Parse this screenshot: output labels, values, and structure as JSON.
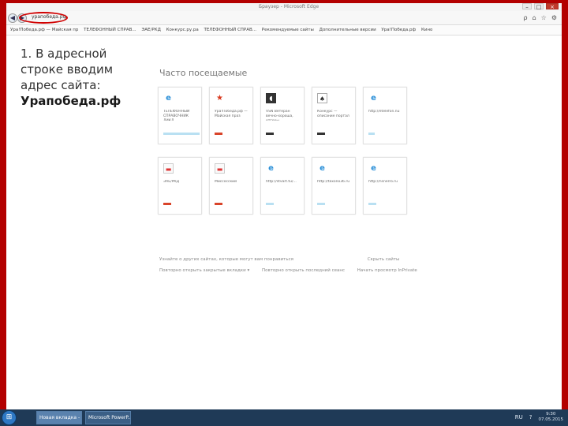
{
  "window": {
    "title": "Браузер - Microsoft Edge",
    "minimize_glyph": "–",
    "maximize_glyph": "□",
    "close_glyph": "×"
  },
  "navbar": {
    "back_glyph": "◀",
    "forward_glyph": "▶",
    "address": "урапобеда.рф",
    "search_glyph": "ρ",
    "home_glyph": "⌂",
    "favorites_glyph": "☆",
    "settings_glyph": "⚙"
  },
  "favbar": {
    "items": [
      "Ура!Победа.рф — Майская пр",
      "ТЕЛЕФОННЫЙ СПРАВ...",
      "ЭАЕ/РКД",
      "Конкурс.ру.ра",
      "ТЕЛЕФОННЫЙ СПРАВ...",
      "Рекомендуемые сайты",
      "Дополнительные версии",
      "Ура!Победа.рф",
      "Кино"
    ]
  },
  "instruction": {
    "line1": "1. В адресной",
    "line2": "строке вводим",
    "line3": "адрес сайта:",
    "site": "Урапобеда.рф"
  },
  "section_title": "Часто посещаемые",
  "tiles": [
    {
      "label": "ТЕЛЕФОННЫЙ СПРАВОЧНИК ЛИКД",
      "bar_color": "#b9e0f2",
      "icon_glyph": "e"
    },
    {
      "label": "Ура!Победа.рф — Майская праз",
      "bar_color": "#d9442a",
      "icon_glyph": "★"
    },
    {
      "label": "VSN Ветеран вечно-хороша, отгоры",
      "bar_color": "#333333",
      "icon_glyph": "◖"
    },
    {
      "label": "Конкурс — описание портал",
      "bar_color": "#333333",
      "icon_glyph": "♠"
    },
    {
      "label": "http://etelefon.nu",
      "bar_color": "#b9e0f2",
      "icon_glyph": "e"
    },
    {
      "label": "ЭАЕ/РКД",
      "bar_color": "#d9442a",
      "icon_glyph": "▬"
    },
    {
      "label": "Миссосский",
      "bar_color": "#d9442a",
      "icon_glyph": "▬"
    },
    {
      "label": "http://stvart.tu/...",
      "bar_color": "#b9e0f2",
      "icon_glyph": "e"
    },
    {
      "label": "http://taxono36.ru",
      "bar_color": "#b9e0f2",
      "icon_glyph": "e"
    },
    {
      "label": "http://nsnerro.ru",
      "bar_color": "#b9e0f2",
      "icon_glyph": "e"
    }
  ],
  "bottom_links": {
    "row1_left": "Узнайте о других сайтах, которые могут вам понравиться",
    "row1_right": "Скрыть сайты",
    "row2_a": "Повторно открыть закрытые вкладки ▾",
    "row2_b": "Повторно открыть последний сеанс",
    "row2_c": "Начать просмотр InPrivate"
  },
  "taskbar": {
    "start_glyph": "⊞",
    "items": [
      "Новая вкладка - I...",
      "Microsoft PowerP..."
    ],
    "lang": "RU",
    "help_glyph": "?",
    "time": "9:30",
    "date": "07.05.2015"
  }
}
